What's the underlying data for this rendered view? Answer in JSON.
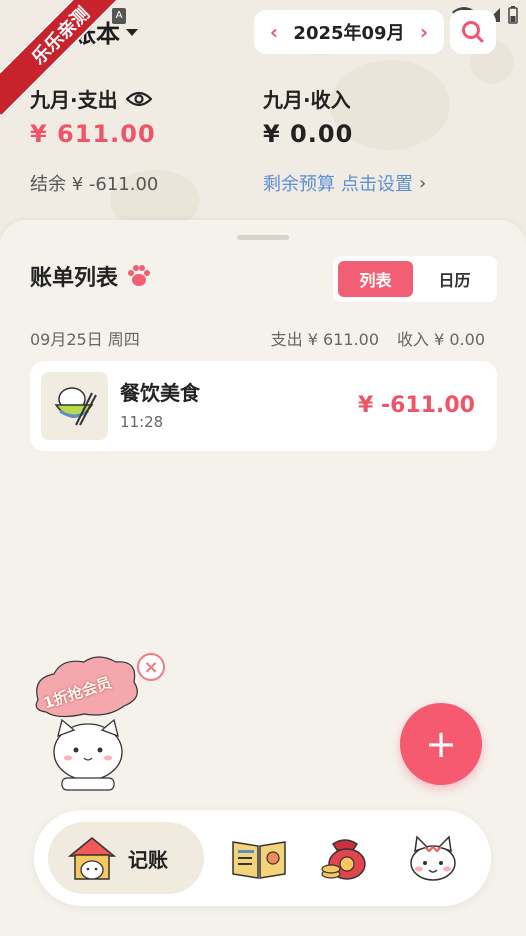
{
  "header": {
    "ribbon_text": "乐乐亲测",
    "book_title": "常账本",
    "month_label": "2025年09月",
    "prev_icon": "chevron-left-icon",
    "next_icon": "chevron-right-icon",
    "search_icon": "search-icon"
  },
  "summary": {
    "expense_label": "九月·支出",
    "expense_value": "¥ 611.00",
    "income_label": "九月·收入",
    "income_value": "¥ 0.00",
    "balance_text": "结余 ¥ -611.00",
    "budget_label": "剩余预算",
    "budget_action": "点击设置"
  },
  "list": {
    "title": "账单列表",
    "toggle": [
      "列表",
      "日历"
    ],
    "active_toggle": "列表",
    "day": {
      "date": "09月25日 周四",
      "expense": "支出 ¥ 611.00",
      "income": "收入 ¥ 0.00"
    },
    "transactions": [
      {
        "category": "餐饮美食",
        "time": "11:28",
        "amount": "¥ -611.00",
        "icon": "rice-bowl-icon"
      }
    ]
  },
  "promo": {
    "text": "1折抢会员",
    "close_icon": "close-icon"
  },
  "fab": {
    "icon": "plus-icon"
  },
  "nav": {
    "active_label": "记账",
    "items": [
      "house-cat-icon",
      "open-book-icon",
      "money-bag-icon",
      "cat-face-icon"
    ]
  },
  "colors": {
    "accent": "#f25e73",
    "link": "#5b8fd6",
    "ribbon": "#c8232c"
  }
}
